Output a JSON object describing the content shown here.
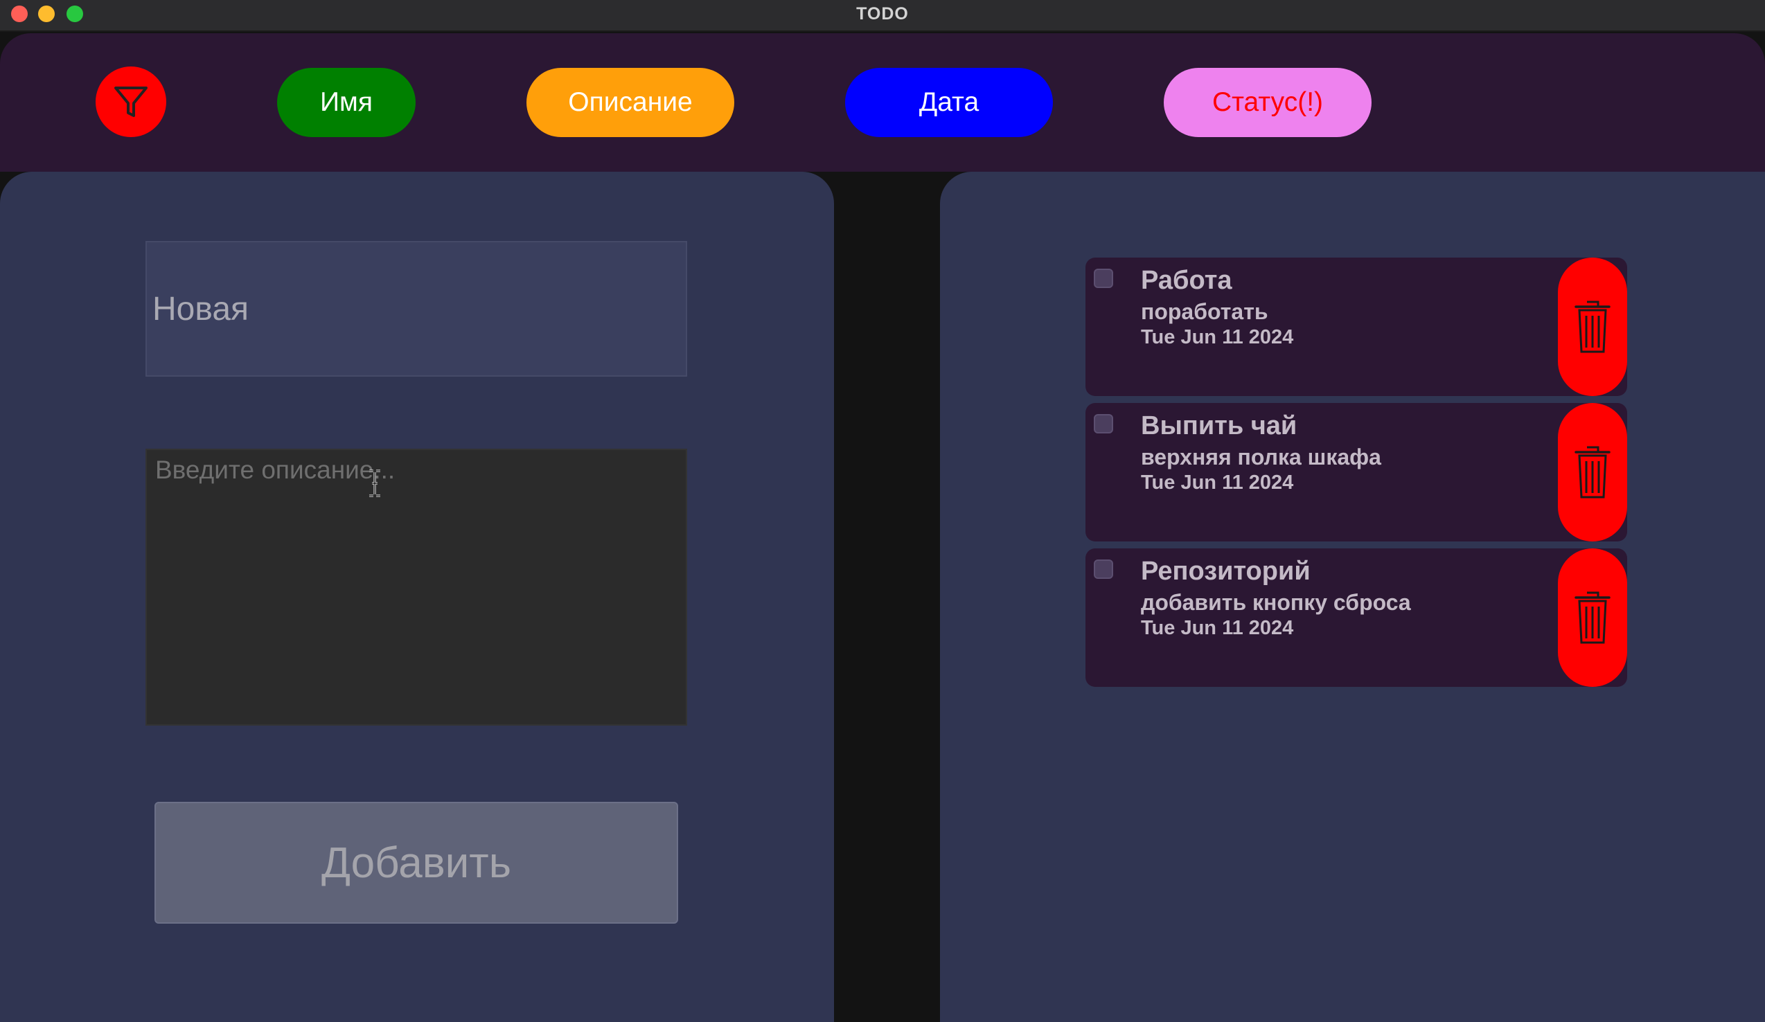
{
  "window": {
    "title": "TODO"
  },
  "toolbar": {
    "filter_icon": "filter-icon",
    "sort_buttons": {
      "name": "Имя",
      "description": "Описание",
      "date": "Дата",
      "status": "Статус(!)"
    },
    "colors": {
      "filter": "#ff0000",
      "name": "#008000",
      "description": "#ff9f0a",
      "date": "#0000ff",
      "status": "#ee82ee"
    }
  },
  "form": {
    "name_value": "",
    "name_placeholder": "Новая",
    "description_value": "",
    "description_placeholder": "Введите описание...",
    "add_label": "Добавить"
  },
  "todos": [
    {
      "title": "Работа",
      "description": "поработать",
      "date": "Tue Jun 11 2024",
      "done": false
    },
    {
      "title": "Выпить чай",
      "description": "верхняя полка шкафа",
      "date": "Tue Jun 11 2024",
      "done": false
    },
    {
      "title": "Репозиторий",
      "description": "добавить кнопку сброса",
      "date": "Tue Jun 11 2024",
      "done": false
    }
  ],
  "icons": {
    "delete": "trash-icon",
    "text_cursor": "text-cursor-icon"
  }
}
